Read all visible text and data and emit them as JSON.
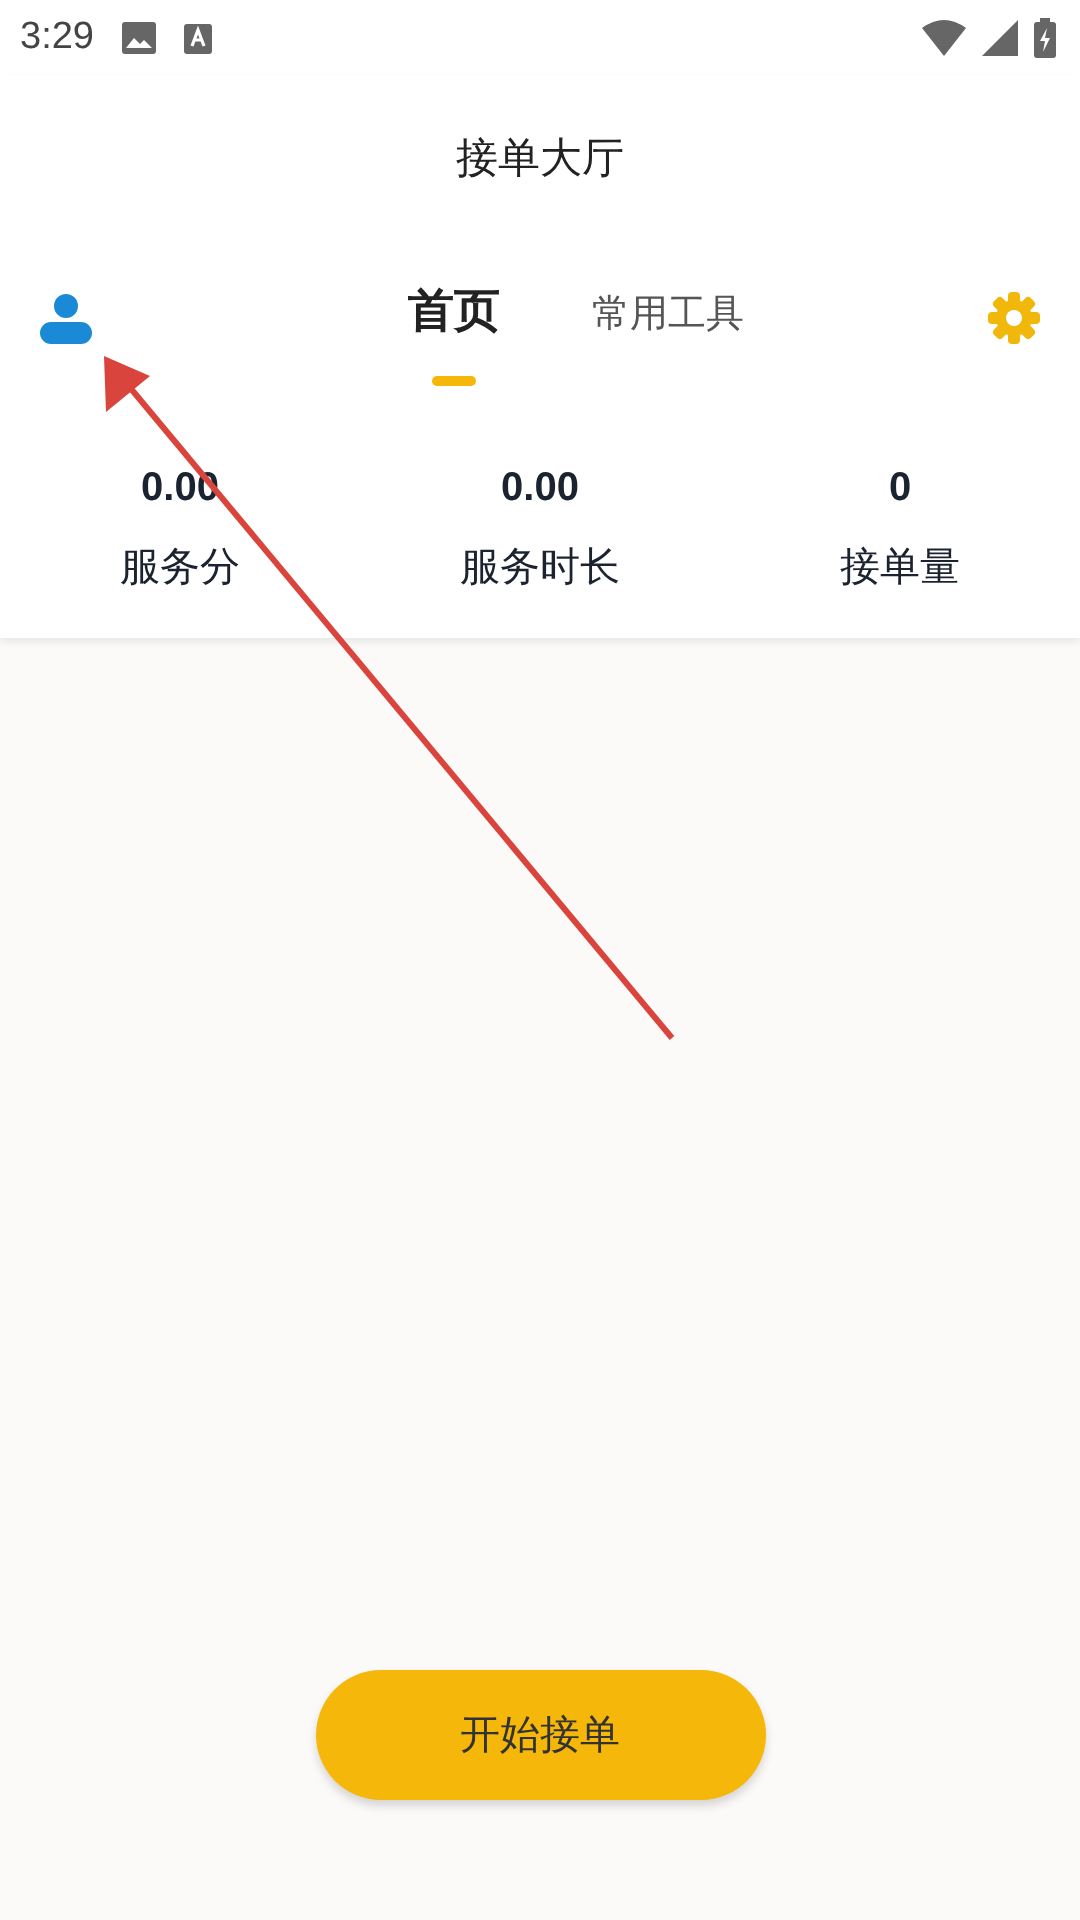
{
  "status_bar": {
    "time": "3:29"
  },
  "window": {
    "title": "接单大厅"
  },
  "tabs": [
    {
      "label": "首页",
      "selected": true
    },
    {
      "label": "常用工具",
      "selected": false
    }
  ],
  "stats": [
    {
      "value": "0.00",
      "label": "服务分"
    },
    {
      "value": "0.00",
      "label": "服务时长"
    },
    {
      "value": "0",
      "label": "接单量"
    }
  ],
  "primary_button": {
    "label": "开始接单"
  }
}
